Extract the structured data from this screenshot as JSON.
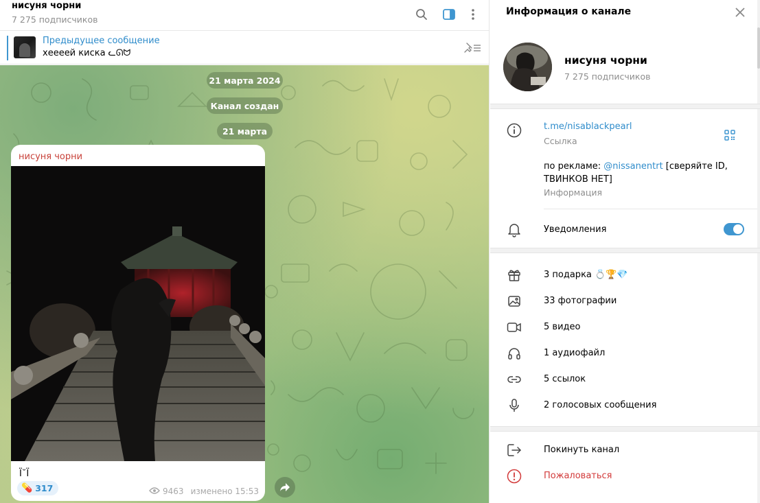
{
  "chat": {
    "title": "нисуня чорни",
    "subscribers": "7 275 подписчиков",
    "header_icons": [
      "search-icon",
      "sidebar-toggle-icon",
      "more-vertical-icon"
    ],
    "pinned": {
      "title": "Предыдущее сообщение",
      "text": "хеееей киска ᓚᘏᗢ"
    },
    "dates": [
      "21 марта 2024",
      "Канал создан",
      "21 марта"
    ],
    "message": {
      "author": "нисуня чорни",
      "caption": "Ϊ˘Ϊ",
      "reaction_emoji": "💊",
      "reaction_count": "317",
      "views": "9463",
      "edited": "изменено 15:53"
    }
  },
  "info": {
    "title": "Информация о канале",
    "name": "нисуня чорни",
    "subscribers": "7 275 подписчиков",
    "link": "t.me/nisablackpearl",
    "link_label": "Ссылка",
    "desc_prefix": "по рекламе: ",
    "desc_mention": "@nissanentrt",
    "desc_suffix": " [сверяйте ID,",
    "desc_line2": "ТВИНКОВ НЕТ]",
    "desc_label": "Информация",
    "notifications": "Уведомления",
    "notifications_on": true,
    "media": [
      {
        "icon": "gift-icon",
        "label": "3 подарка 💍🏆💎"
      },
      {
        "icon": "photo-icon",
        "label": "33 фотографии"
      },
      {
        "icon": "video-icon",
        "label": "5 видео"
      },
      {
        "icon": "headphones-icon",
        "label": "1 аудиофайл"
      },
      {
        "icon": "link-icon",
        "label": "5 ссылок"
      },
      {
        "icon": "microphone-icon",
        "label": "2 голосовых сообщения"
      }
    ],
    "leave": "Покинуть канал",
    "report": "Пожаловаться"
  },
  "colors": {
    "accent": "#3f96d0",
    "author": "#c8423a",
    "danger": "#d23a3a"
  }
}
